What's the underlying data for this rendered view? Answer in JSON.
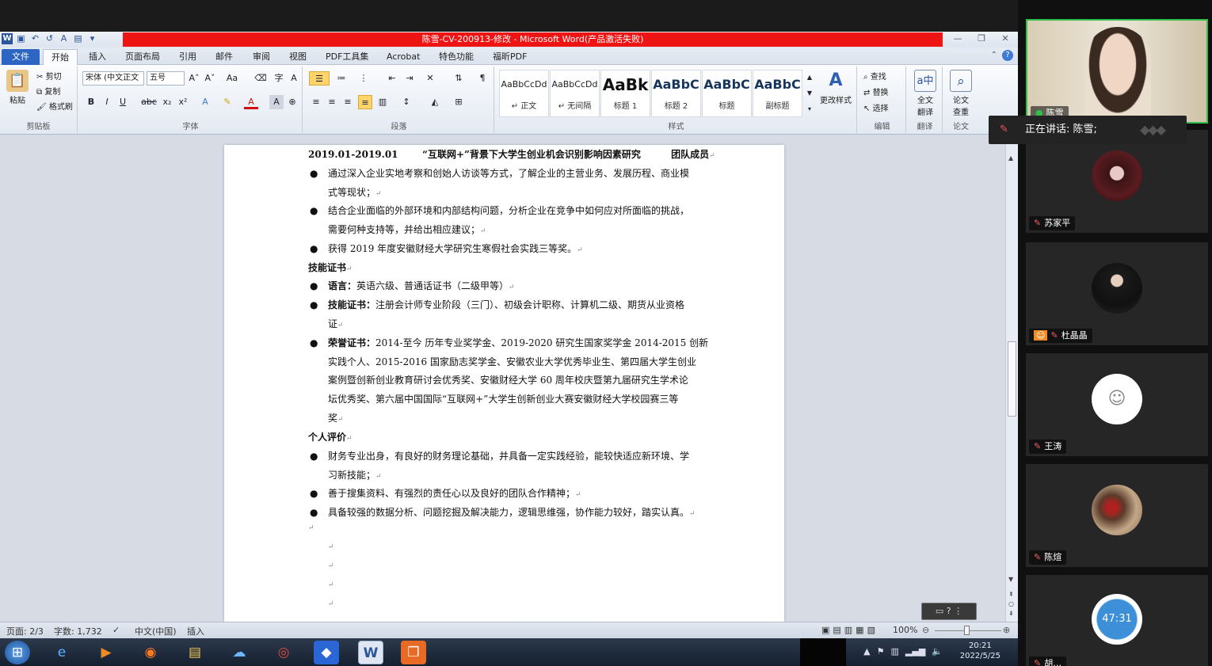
{
  "window": {
    "title": "陈雪-CV-200913-修改 - Microsoft Word(产品激活失败)"
  },
  "qat": {
    "app_icon": "W",
    "undo": "↶",
    "redo": "↺"
  },
  "tabs": [
    "文件",
    "开始",
    "插入",
    "页面布局",
    "引用",
    "邮件",
    "审阅",
    "视图",
    "PDF工具集",
    "Acrobat",
    "特色功能",
    "福昕PDF"
  ],
  "ribbon": {
    "clipboard": {
      "label": "剪贴板",
      "paste": "粘贴",
      "cut": "剪切",
      "copy": "复制",
      "format_painter": "格式刷"
    },
    "font": {
      "label": "字体",
      "font_name": "宋体 (中文正文",
      "font_size": "五号",
      "bold": "B",
      "italic": "I",
      "underline": "U",
      "strike": "abc"
    },
    "paragraph": {
      "label": "段落"
    },
    "styles": {
      "label": "样式",
      "change": "更改样式",
      "items": [
        {
          "preview": "AaBbCcDd",
          "name": "↵ 正文"
        },
        {
          "preview": "AaBbCcDd",
          "name": "↵ 无间隔"
        },
        {
          "preview": "AaBk",
          "name": "标题 1"
        },
        {
          "preview": "AaBbC",
          "name": "标题 2"
        },
        {
          "preview": "AaBbC",
          "name": "标题"
        },
        {
          "preview": "AaBbC",
          "name": "副标题"
        }
      ]
    },
    "editing": {
      "label": "编辑",
      "find": "查找",
      "replace": "替换",
      "select": "选择"
    },
    "translate": {
      "label": "翻译",
      "btn1": "全文",
      "btn2": "翻译"
    },
    "thesis": {
      "label": "论文",
      "btn1": "论文",
      "btn2": "查重"
    }
  },
  "doc": {
    "line1_date": "2019.01-2019.01",
    "line1_title": "“互联网+”背景下大学生创业机会识别影响因素研究",
    "line1_role": "团队成员",
    "p1a": "通过深入企业实地考察和创始人访谈等方式，了解企业的主营业务、发展历程、商业模",
    "p1b": "式等现状；",
    "p2a": "结合企业面临的外部环境和内部结构问题，分析企业在竞争中如何应对所面临的挑战，",
    "p2b": "需要何种支持等，并给出相应建议；",
    "p3": "获得 2019 年度安徽财经大学研究生寒假社会实践三等奖。",
    "h_skill": "技能证书",
    "lang_label": "语言：",
    "lang_text": "英语六级、普通话证书（二级甲等）",
    "cert_label": "技能证书：",
    "cert_a": "注册会计师专业阶段（三门）、初级会计职称、计算机二级、期货从业资格",
    "cert_b": "证",
    "honor_label": "荣誉证书：",
    "honor_a": "2014-至今 历年专业奖学金、2019-2020 研究生国家奖学金 2014-2015 创新",
    "honor_b": "实践个人、2015-2016 国家励志奖学金、安徽农业大学优秀毕业生、第四届大学生创业",
    "honor_c": "案例暨创新创业教育研讨会优秀奖、安徽财经大学 60 周年校庆暨第九届研究生学术论",
    "honor_d": "坛优秀奖、第六届中国国际“互联网+”大学生创新创业大赛安徽财经大学校园赛三等",
    "honor_e": "奖",
    "h_eval": "个人评价",
    "e1a": "财务专业出身，有良好的财务理论基础，并具备一定实践经验，能较快适应新环境、学",
    "e1b": "习新技能；",
    "e2": "善于搜集资料、有强烈的责任心以及良好的团队合作精神；",
    "e3": "具备较强的数据分析、问题挖掘及解决能力，逻辑思维强，协作能力较好，踏实认真。",
    "mark": "↵",
    "bullet": "●"
  },
  "status": {
    "page": "页面: 2/3",
    "words": "字数: 1,732",
    "lang": "中文(中国)",
    "mode": "插入",
    "zoom": "100%"
  },
  "taskbar": {
    "time": "20:21",
    "date": "2022/5/25"
  },
  "meeting": {
    "speaking": "正在讲话: 陈雪;",
    "participants": [
      {
        "name": "陈雪"
      },
      {
        "name": "苏家平"
      },
      {
        "name": "杜晶晶"
      },
      {
        "name": "王涛"
      },
      {
        "name": "陈煊"
      },
      {
        "name": "胡…",
        "avatar_text": "47:31"
      }
    ]
  },
  "colors": {
    "title_red": "#ee1414",
    "file_tab": "#2d66c2",
    "highlight": "#ffd56b"
  }
}
